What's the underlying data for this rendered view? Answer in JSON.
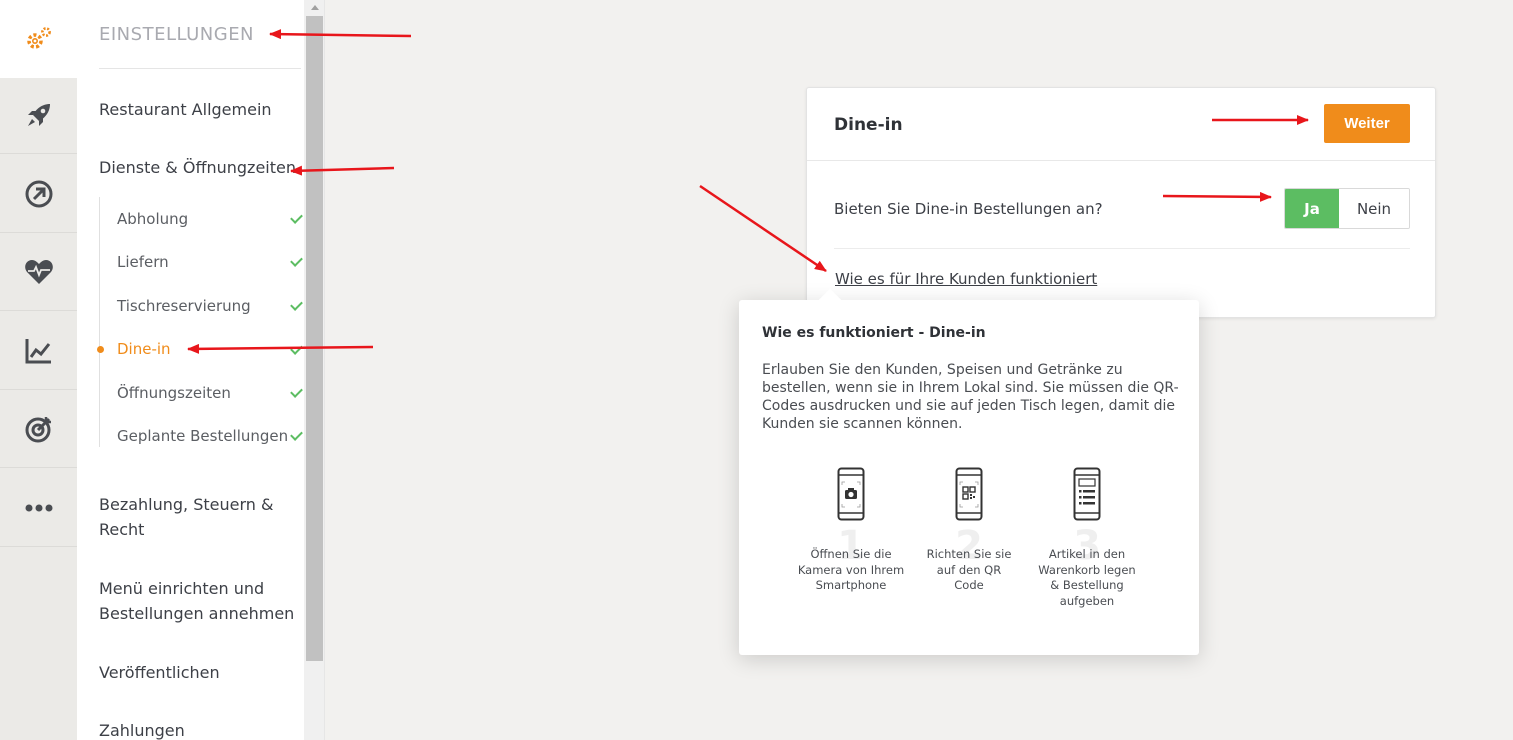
{
  "rail": {
    "items": [
      {
        "icon": "gears-icon",
        "active": true
      },
      {
        "icon": "rocket-icon"
      },
      {
        "icon": "circle-arrow-icon"
      },
      {
        "icon": "heart-pulse-icon"
      },
      {
        "icon": "chart-line-icon"
      },
      {
        "icon": "target-icon"
      },
      {
        "icon": "more-dots-icon"
      }
    ]
  },
  "settings": {
    "title": "EINSTELLUNGEN",
    "restaurant": "Restaurant Allgemein",
    "services": "Dienste & Öffnungzeiten",
    "subitems": [
      {
        "label": "Abholung",
        "done": true
      },
      {
        "label": "Liefern",
        "done": true
      },
      {
        "label": "Tischreservierung",
        "done": true
      },
      {
        "label": "Dine-in",
        "active": true
      },
      {
        "label": "Öffnungszeiten",
        "done": true
      },
      {
        "label": "Geplante Bestellungen",
        "done": true
      }
    ],
    "payment_line1": "Bezahlung, Steuern &",
    "payment_line2": "Recht",
    "menu_line1": "Menü einrichten und",
    "menu_line2": "Bestellungen annehmen",
    "publish": "Veröffentlichen",
    "payments": "Zahlungen"
  },
  "card": {
    "title": "Dine-in",
    "next_button": "Weiter",
    "question": "Bieten Sie Dine-in Bestellungen an?",
    "toggle": {
      "yes": "Ja",
      "no": "Nein",
      "selected": "Ja"
    },
    "how_link": "Wie es für Ihre Kunden funktioniert"
  },
  "popover": {
    "title": "Wie es funktioniert - Dine-in",
    "body": "Erlauben Sie den Kunden, Speisen und Getränke zu bestellen, wenn sie in Ihrem Lokal sind. Sie müssen die QR-Codes ausdrucken und sie auf jeden Tisch legen, damit die Kunden sie scannen können.",
    "steps": [
      {
        "number": "1",
        "lines": [
          "Öffnen Sie die",
          "Kamera von Ihrem",
          "Smartphone"
        ],
        "icon": "phone-camera-icon"
      },
      {
        "number": "2",
        "lines": [
          "Richten Sie sie",
          "auf den QR",
          "Code"
        ],
        "icon": "phone-qr-icon"
      },
      {
        "number": "3",
        "lines": [
          "Artikel in den",
          "Warenkorb legen",
          "& Bestellung",
          "aufgeben"
        ],
        "icon": "phone-list-icon"
      }
    ]
  },
  "colors": {
    "accent": "#f08c1b",
    "success": "#5cbd62",
    "annotation": "#e8161b"
  }
}
